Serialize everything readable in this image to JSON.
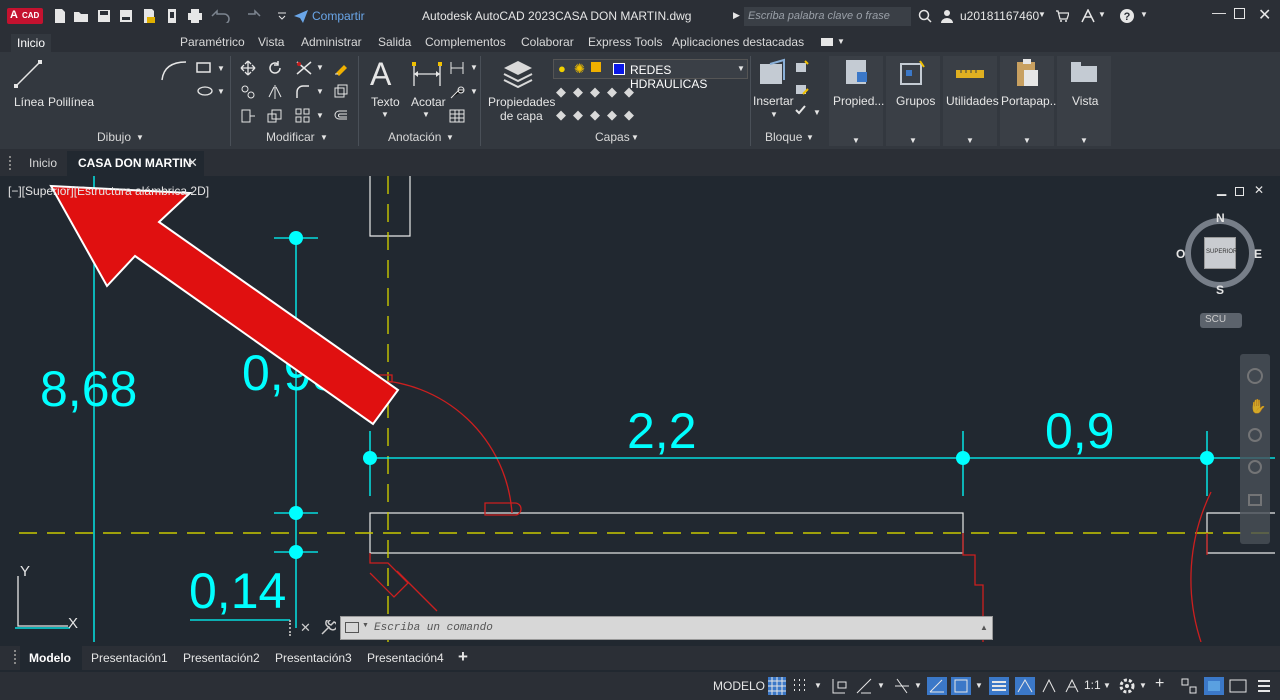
{
  "titlebar": {
    "logo_text": "CAD",
    "share_label": "Compartir",
    "app_title": "Autodesk AutoCAD 2023",
    "file_name": "CASA DON MARTIN.dwg",
    "search_placeholder": "Escriba palabra clave o frase",
    "user": "u20181167460"
  },
  "ribbon_tabs": [
    "Inicio",
    "Paramétrico",
    "Vista",
    "Administrar",
    "Salida",
    "Complementos",
    "Colaborar",
    "Express Tools",
    "Aplicaciones destacadas"
  ],
  "ribbon": {
    "draw": {
      "line": "Línea",
      "polyline": "Polilínea",
      "title": "Dibujo"
    },
    "modify": {
      "title": "Modificar"
    },
    "annotation": {
      "text": "Texto",
      "dimension": "Acotar",
      "title": "Anotación"
    },
    "layers": {
      "properties": "Propiedades",
      "properties2": "de capa",
      "current_layer": "REDES HDRAULICAS",
      "title": "Capas"
    },
    "block": {
      "insert": "Insertar",
      "title": "Bloque"
    },
    "right_panels": [
      "Propied...",
      "Grupos",
      "Utilidades",
      "Portapap...",
      "Vista"
    ]
  },
  "doc_tabs": {
    "home": "Inicio",
    "current": "CASA DON MARTIN"
  },
  "viewport": {
    "label": "[−][Superior][Estructura alámbrica 2D]",
    "viewcube": {
      "n": "N",
      "s": "S",
      "e": "E",
      "w": "O",
      "face": "SUPERIOR",
      "ucs": "SCU"
    },
    "dimensions": [
      "8,68",
      "0,99",
      "2,2",
      "0,9",
      "0,14"
    ],
    "ucs_x": "X",
    "ucs_y": "Y"
  },
  "command_line": {
    "placeholder": "Escriba un comando"
  },
  "layout_tabs": [
    "Modelo",
    "Presentación1",
    "Presentación2",
    "Presentación3",
    "Presentación4"
  ],
  "status": {
    "model": "MODELO",
    "scale": "1:1"
  },
  "colors": {
    "dimension": "#00ffff",
    "centerline": "#c8c800",
    "door": "#cc1f1f",
    "wall": "#ffffff",
    "arrow": "#e01010"
  }
}
